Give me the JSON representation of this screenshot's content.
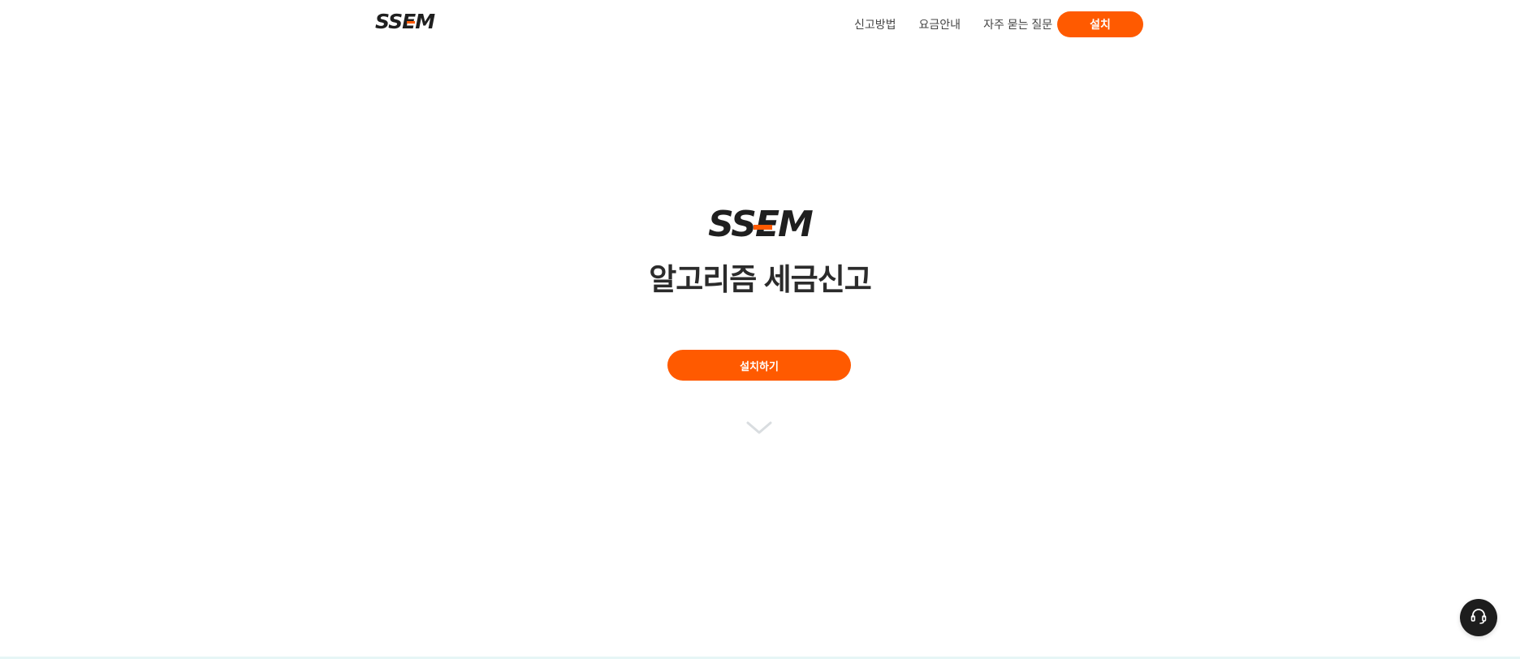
{
  "brand": {
    "name": "SSEM",
    "accent_color": "#ff5a00",
    "text_color": "#1f1f1f"
  },
  "header": {
    "nav_items": [
      {
        "label": "신고방법"
      },
      {
        "label": "요금안내"
      },
      {
        "label": "자주 묻는 질문"
      }
    ],
    "install_label": "설치"
  },
  "hero": {
    "logo_text": "SSEM",
    "headline": "알고리즘 세금신고",
    "install_label": "설치하기",
    "scroll_icon": "chevron-down-icon"
  },
  "support": {
    "icon": "headset-icon"
  }
}
